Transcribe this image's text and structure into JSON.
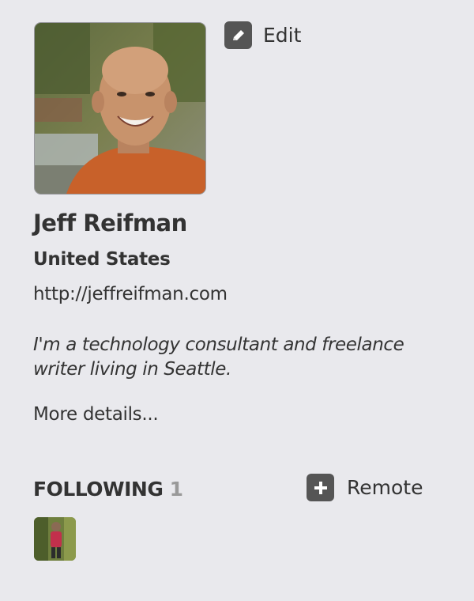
{
  "profile": {
    "name": "Jeff Reifman",
    "location": "United States",
    "website": "http://jeffreifman.com",
    "bio": "I'm a technology consultant and freelance writer living in Seattle.",
    "more_details": "More details...",
    "photo_icon": "profile-photo"
  },
  "actions": {
    "edit_label": "Edit",
    "edit_icon": "pencil-icon",
    "remote_label": "Remote",
    "remote_icon": "plus-icon"
  },
  "following": {
    "heading": "FOLLOWING",
    "count": "1",
    "users": [
      {
        "avatar": "user-avatar"
      }
    ]
  },
  "colors": {
    "background": "#e9e9ed",
    "text": "#333333",
    "muted": "#999999",
    "icon_bg": "#555555"
  }
}
